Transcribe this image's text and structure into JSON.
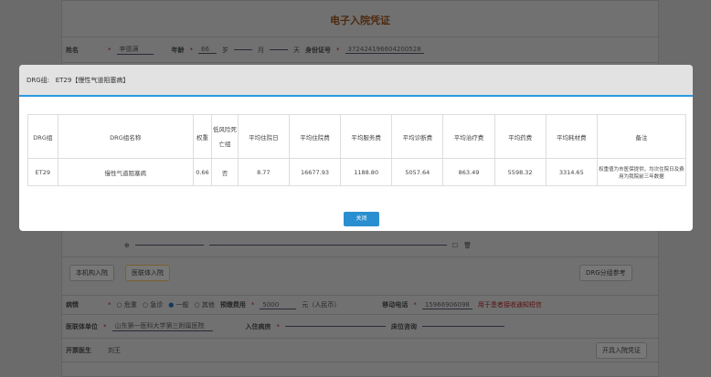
{
  "form": {
    "title": "电子入院凭证",
    "name_label": "姓名",
    "name_value": "李德满",
    "age_label": "年龄",
    "age_value": "66",
    "age_unit": "岁",
    "month_unit": "月",
    "day_unit": "天",
    "id_label": "身份证号",
    "id_value": "372424196604200528",
    "btn_local": "本机构入院",
    "btn_union": "医联体入院",
    "btn_drg": "DRG分组参考",
    "condition_label": "病情",
    "conditions": [
      "危重",
      "急诊",
      "一般",
      "其他"
    ],
    "condition_selected": "一般",
    "deposit_label": "预缴费用",
    "deposit_value": "5000",
    "deposit_unit": "元（人民币）",
    "phone_label": "移动电话",
    "phone_value": "15966906098",
    "phone_hint": "用于患者接收通知短信",
    "unit_label": "医联体单位",
    "unit_value": "山东第一医科大学第三附属医院",
    "ward_label": "入住病房",
    "bed_label": "床位咨询",
    "doctor_label": "开票医生",
    "doctor_value": "刘王",
    "issue_button": "开具入院凭证"
  },
  "modal": {
    "header_label": "DRG组:",
    "header_value": "ET29【慢性气道阻塞病】",
    "columns": [
      "DRG组",
      "DRG组名称",
      "权重",
      "低风险死亡组",
      "平均住院日",
      "平均住院费",
      "平均服务费",
      "平均诊断费",
      "平均治疗费",
      "平均药费",
      "平均耗材费",
      "备注"
    ],
    "row": [
      "ET29",
      "慢性气道阻塞病",
      "0.66",
      "否",
      "8.77",
      "16677.93",
      "1188.80",
      "5057.64",
      "863.49",
      "5598.32",
      "3314.65",
      "权重值为市医保提供，均次住院日及费用为我院前三年数据"
    ],
    "close_label": "关闭"
  },
  "colors": {
    "accent": "#2a8fd0",
    "title": "#a0521a",
    "hint": "#cc0000"
  }
}
